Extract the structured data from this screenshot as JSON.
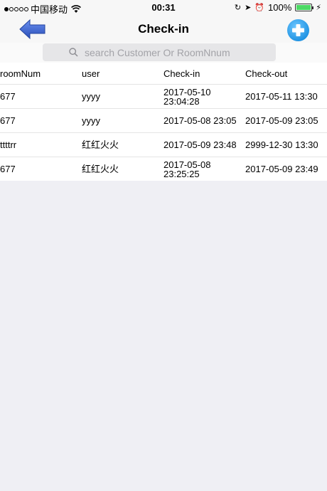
{
  "status_bar": {
    "carrier": "中国移动",
    "time": "00:31",
    "battery": "100%",
    "battery_level": 1.0
  },
  "nav": {
    "title": "Check-in",
    "back_icon": "arrow-left-icon",
    "add_icon": "plus-circle-icon"
  },
  "search": {
    "placeholder": "search Customer Or RoomNnum"
  },
  "table": {
    "headers": [
      "roomNum",
      "user",
      "Check-in",
      "Check-out"
    ],
    "rows": [
      {
        "room": "677",
        "user": "yyyy",
        "checkin": "2017-05-10 23:04:28",
        "checkout": "2017-05-11 13:30"
      },
      {
        "room": "677",
        "user": "yyyy",
        "checkin": "2017-05-08 23:05",
        "checkout": "2017-05-09 23:05"
      },
      {
        "room": "ttttrr",
        "user": "红红火火",
        "checkin": "2017-05-09 23:48",
        "checkout": "2999-12-30 13:30"
      },
      {
        "room": "677",
        "user": "红红火火",
        "checkin": "2017-05-08 23:25:25",
        "checkout": "2017-05-09 23:49"
      }
    ]
  },
  "colors": {
    "accent_blue": "#1a8fe0",
    "back_arrow": "#3b63c9",
    "battery_green": "#4cd964"
  }
}
